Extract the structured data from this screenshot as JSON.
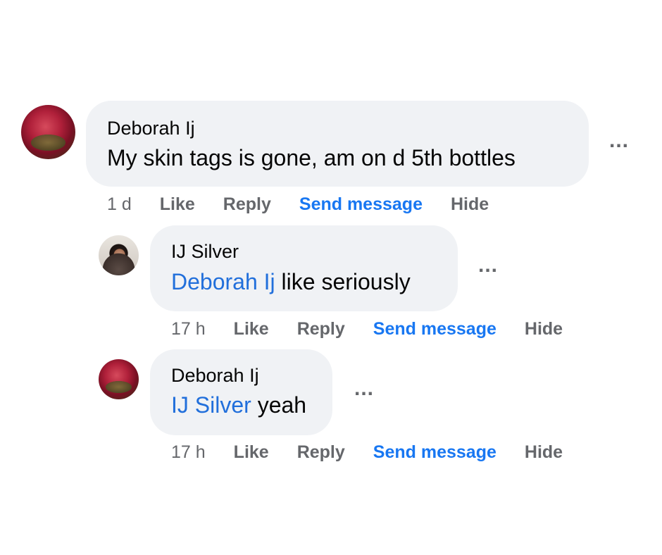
{
  "comments": [
    {
      "author": "Deborah Ij",
      "mention": "",
      "text": "My skin tags is gone, am on d 5th bottles",
      "time": "1 d",
      "actions": {
        "like": "Like",
        "reply": "Reply",
        "send": "Send message",
        "hide": "Hide"
      },
      "more": "..."
    },
    {
      "author": "IJ Silver",
      "mention": "Deborah Ij",
      "text": " like seriously",
      "time": "17 h",
      "actions": {
        "like": "Like",
        "reply": "Reply",
        "send": "Send message",
        "hide": "Hide"
      },
      "more": "..."
    },
    {
      "author": "Deborah Ij",
      "mention": "IJ Silver",
      "text": " yeah",
      "time": "17 h",
      "actions": {
        "like": "Like",
        "reply": "Reply",
        "send": "Send message",
        "hide": "Hide"
      },
      "more": "..."
    }
  ],
  "colors": {
    "mention": "#216fdb",
    "send": "#1877f2",
    "bubble": "#f0f2f5",
    "meta": "#65676b"
  }
}
